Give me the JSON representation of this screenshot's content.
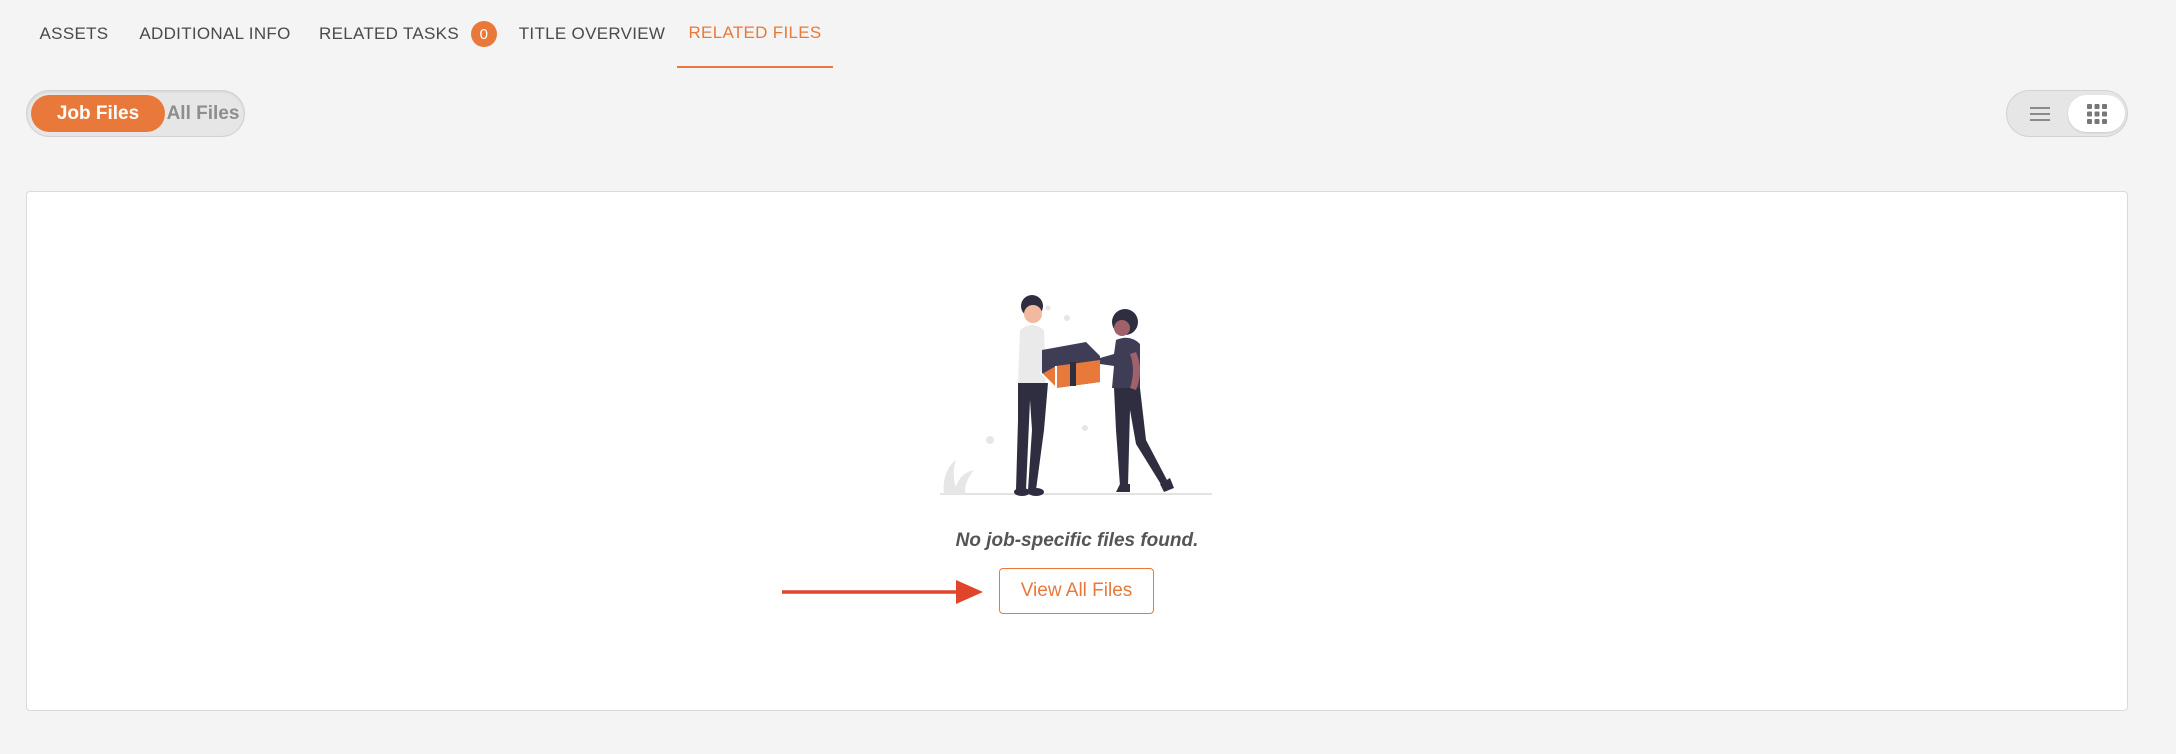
{
  "tabs": [
    {
      "label": "ASSETS",
      "active": false
    },
    {
      "label": "ADDITIONAL INFO",
      "active": false
    },
    {
      "label": "RELATED TASKS",
      "active": false,
      "badge": "0"
    },
    {
      "label": "TITLE OVERVIEW",
      "active": false
    },
    {
      "label": "RELATED FILES",
      "active": true
    }
  ],
  "file_scope": {
    "options": [
      "Job Files",
      "All Files"
    ],
    "selected": "Job Files"
  },
  "view_mode": {
    "options": [
      "list-icon",
      "grid-icon"
    ],
    "selected": "grid-icon"
  },
  "empty_state": {
    "illustration": "people-handing-box-illustration",
    "message": "No job-specific files found.",
    "button_label": "View All Files"
  },
  "colors": {
    "accent": "#e8793a",
    "arrow": "#e0442a",
    "background": "#f4f4f4",
    "panel": "#ffffff"
  }
}
